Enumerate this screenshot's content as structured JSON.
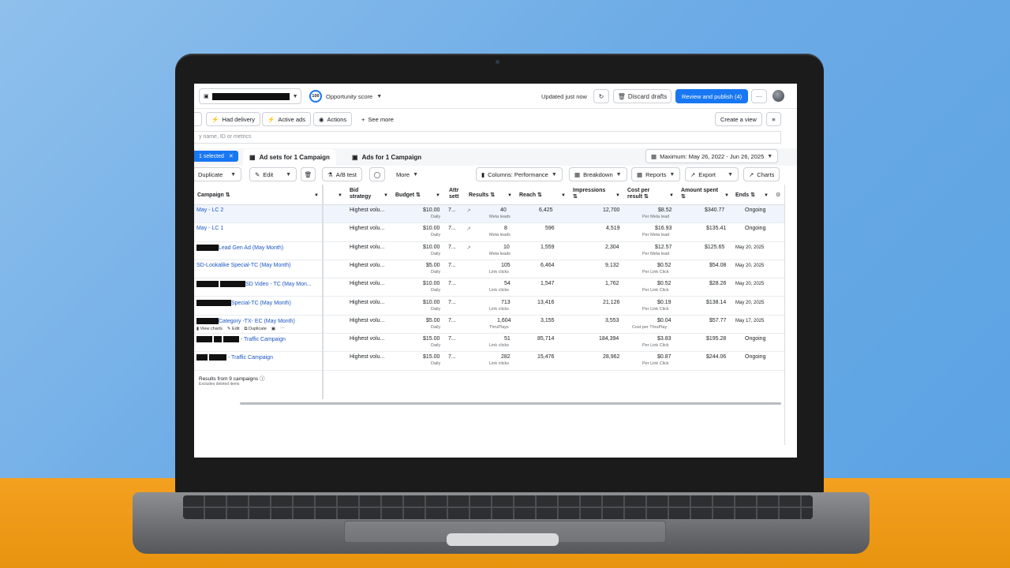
{
  "topbar": {
    "opportunity_badge": "100",
    "opportunity_label": "Opportunity score",
    "updated": "Updated just now",
    "discard": "Discard drafts",
    "publish": "Review and publish (4)",
    "more": "···"
  },
  "filters": {
    "had_delivery": "Had delivery",
    "active_ads": "Active ads",
    "actions": "Actions",
    "see_more": "See more",
    "create_view": "Create a view"
  },
  "search": {
    "placeholder": "y name, ID or metrics"
  },
  "tabs": {
    "selected": "1 selected",
    "ad_sets": "Ad sets for 1 Campaign",
    "ads": "Ads for 1 Campaign",
    "date_range": "Maximum: May 26, 2022 - Jun 26, 2025"
  },
  "toolbar": {
    "duplicate": "Duplicate",
    "edit": "Edit",
    "ab_test": "A/B test",
    "more": "More",
    "columns": "Columns: Performance",
    "breakdown": "Breakdown",
    "reports": "Reports",
    "export": "Export",
    "charts": "Charts"
  },
  "table": {
    "headers": {
      "campaign": "Campaign",
      "bid_a": "Bid",
      "bid_b": "strategy",
      "budget": "Budget",
      "attr_a": "Attr",
      "attr_b": "sett",
      "results": "Results",
      "reach": "Reach",
      "impressions": "Impressions",
      "cost_a": "Cost per",
      "cost_b": "result",
      "amount": "Amount spent",
      "ends": "Ends"
    },
    "rows": [
      {
        "name": "May - LC 2",
        "bid": "Highest volu...",
        "budget": "$10.00",
        "budget_sub": "Daily",
        "attr": "7...",
        "results": "40",
        "results_sub": "Meta leads",
        "reach": "6,425",
        "impressions": "12,700",
        "cost": "$8.52",
        "cost_sub": "Per Meta lead",
        "spent": "$340.77",
        "ends": "Ongoing"
      },
      {
        "name": "May - LC 1",
        "bid": "Highest volu...",
        "budget": "$10.00",
        "budget_sub": "Daily",
        "attr": "7...",
        "results": "8",
        "results_sub": "Meta leads",
        "reach": "596",
        "impressions": "4,519",
        "cost": "$16.93",
        "cost_sub": "Per Meta lead",
        "spent": "$135.41",
        "ends": "Ongoing"
      },
      {
        "name": "Lead Gen Ad (May Month)",
        "bid": "Highest volu...",
        "budget": "$10.00",
        "budget_sub": "Daily",
        "attr": "7...",
        "results": "10",
        "results_sub": "Meta leads",
        "reach": "1,559",
        "impressions": "2,304",
        "cost": "$12.57",
        "cost_sub": "Per Meta lead",
        "spent": "$125.65",
        "ends": "May 20, 2025"
      },
      {
        "name": "SD-Lookalike Special-TC (May Month)",
        "bid": "Highest volu...",
        "budget": "$5.00",
        "budget_sub": "Daily",
        "attr": "7...",
        "results": "105",
        "results_sub": "Link clicks",
        "reach": "6,464",
        "impressions": "9,132",
        "cost": "$0.52",
        "cost_sub": "Per Link Click",
        "spent": "$54.08",
        "ends": "May 20, 2025"
      },
      {
        "name": "SD Video - TC (May Mon...",
        "bid": "Highest volu...",
        "budget": "$10.00",
        "budget_sub": "Daily",
        "attr": "7...",
        "results": "54",
        "results_sub": "Link clicks",
        "reach": "1,547",
        "impressions": "1,762",
        "cost": "$0.52",
        "cost_sub": "Per Link Click",
        "spent": "$28.26",
        "ends": "May 20, 2025"
      },
      {
        "name": "Special-TC (May Month)",
        "bid": "Highest volu...",
        "budget": "$10.00",
        "budget_sub": "Daily",
        "attr": "7...",
        "results": "713",
        "results_sub": "Link clicks",
        "reach": "13,416",
        "impressions": "21,126",
        "cost": "$0.19",
        "cost_sub": "Per Link Click",
        "spent": "$138.14",
        "ends": "May 20, 2025"
      },
      {
        "name": "Category -TX- EC (May Month)",
        "bid": "Highest volu...",
        "budget": "$5.00",
        "budget_sub": "Daily",
        "attr": "7...",
        "results": "1,604",
        "results_sub": "ThruPlays",
        "reach": "3,155",
        "impressions": "3,553",
        "cost": "$0.04",
        "cost_sub": "Cost per ThruPlay",
        "spent": "$57.77",
        "ends": "May 17, 2025"
      },
      {
        "name": "- Traffic Campaign",
        "bid": "Highest volu...",
        "budget": "$15.00",
        "budget_sub": "Daily",
        "attr": "7...",
        "results": "51",
        "results_sub": "Link clicks",
        "reach": "85,714",
        "impressions": "184,394",
        "cost": "$3.83",
        "cost_sub": "Per Link Click",
        "spent": "$195.28",
        "ends": "Ongoing"
      },
      {
        "name": "- Traffic Campaign",
        "bid": "Highest volu...",
        "budget": "$15.00",
        "budget_sub": "Daily",
        "attr": "7...",
        "results": "282",
        "results_sub": "Link clicks",
        "reach": "15,476",
        "impressions": "28,962",
        "cost": "$0.87",
        "cost_sub": "Per Link Click",
        "spent": "$244.06",
        "ends": "Ongoing"
      }
    ],
    "row_actions": {
      "view_charts": "View charts",
      "edit": "Edit",
      "duplicate": "Duplicate"
    }
  },
  "footer": {
    "results": "Results from 9 campaigns",
    "excludes": "Excludes deleted items"
  }
}
